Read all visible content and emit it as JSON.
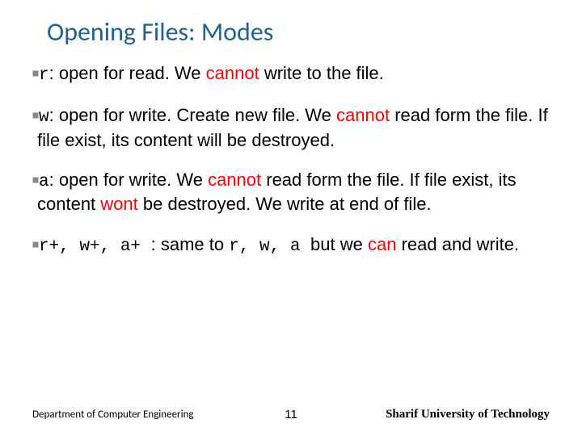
{
  "title": "Opening Files: Modes",
  "bullets": {
    "b1": {
      "mode": "r",
      "t1": ": open for read. We ",
      "red1": "cannot",
      "t2": " write to the file."
    },
    "b2": {
      "mode": "w",
      "t1": ": open for write. Create new file. We ",
      "red1": "cannot",
      "t2": " read form the file. If file exist, its content will be destroyed."
    },
    "b3": {
      "mode": "a",
      "t1": ": open for write. We ",
      "red1": "cannot",
      "t2": " read form the file. If file exist, its content ",
      "red2": "wont",
      "t3": " be destroyed. We write at end of file."
    },
    "b4": {
      "mode": "r+, w+, a+ ",
      "t1": ": same to ",
      "mono2": "r, w, a ",
      "t2": "but we ",
      "red1": "can",
      "t3": " read and write."
    }
  },
  "footer": {
    "left": "Department of Computer Engineering",
    "page": "11",
    "right": "Sharif University of Technology"
  }
}
